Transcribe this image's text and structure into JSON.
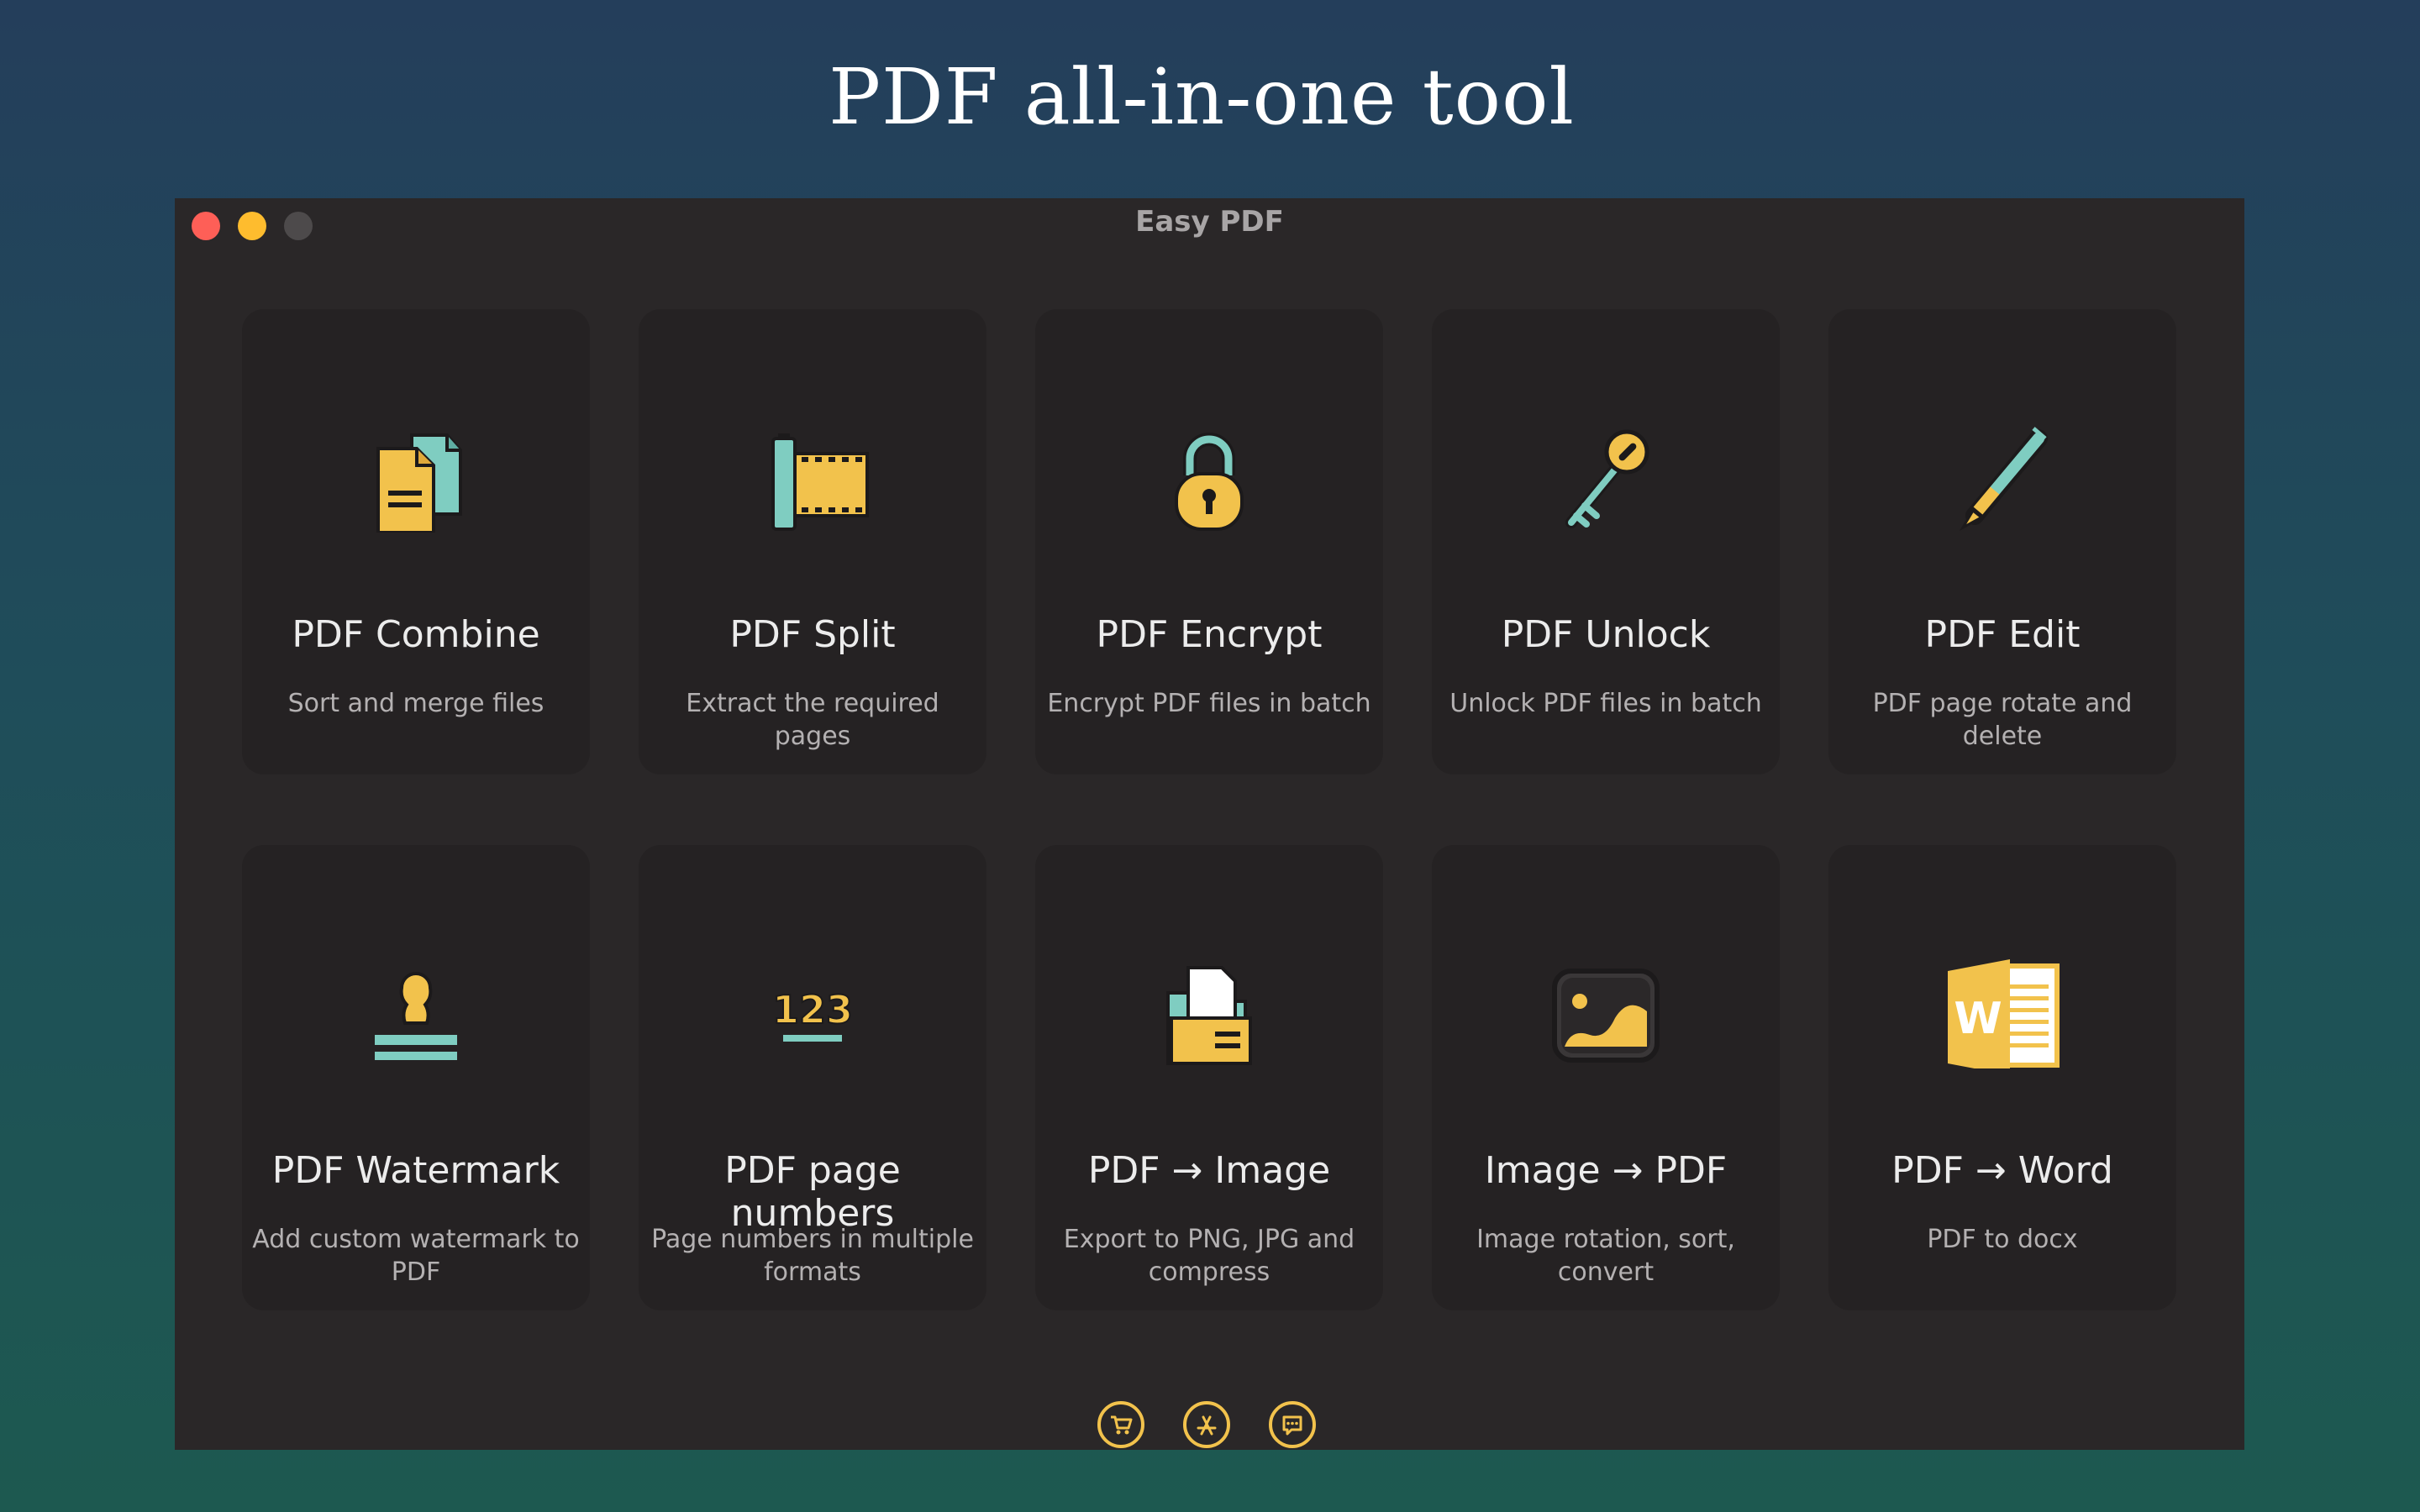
{
  "headline": "PDF all-in-one tool",
  "window": {
    "title": "Easy PDF",
    "controls": [
      "close",
      "minimize",
      "zoom"
    ]
  },
  "tools": [
    {
      "title": "PDF Combine",
      "desc": "Sort and merge files",
      "icon": "combine-files-icon"
    },
    {
      "title": "PDF Split",
      "desc": "Extract the required pages",
      "icon": "film-split-icon"
    },
    {
      "title": "PDF Encrypt",
      "desc": "Encrypt PDF files in batch",
      "icon": "padlock-icon"
    },
    {
      "title": "PDF Unlock",
      "desc": "Unlock PDF files in batch",
      "icon": "key-icon"
    },
    {
      "title": "PDF Edit",
      "desc": "PDF page rotate and delete",
      "icon": "pen-icon"
    },
    {
      "title": "PDF Watermark",
      "desc": "Add custom watermark to PDF",
      "icon": "stamp-icon"
    },
    {
      "title": "PDF page numbers",
      "desc": "Page numbers in multiple formats",
      "icon": "page-numbers-icon",
      "icon_text": "123"
    },
    {
      "title": "PDF → Image",
      "desc": "Export to PNG, JPG and compress",
      "icon": "folder-document-icon"
    },
    {
      "title": "Image → PDF",
      "desc": "Image rotation, sort, convert",
      "icon": "picture-icon"
    },
    {
      "title": "PDF → Word",
      "desc": "PDF to docx",
      "icon": "word-document-icon",
      "icon_text": "W"
    }
  ],
  "bottom_bar": [
    "cart-icon",
    "app-store-icon",
    "feedback-icon"
  ],
  "colors": {
    "accent_yellow": "#f2c24c",
    "accent_teal": "#7fcdc1",
    "card_bg": "#252223",
    "window_bg": "#2a2728"
  }
}
